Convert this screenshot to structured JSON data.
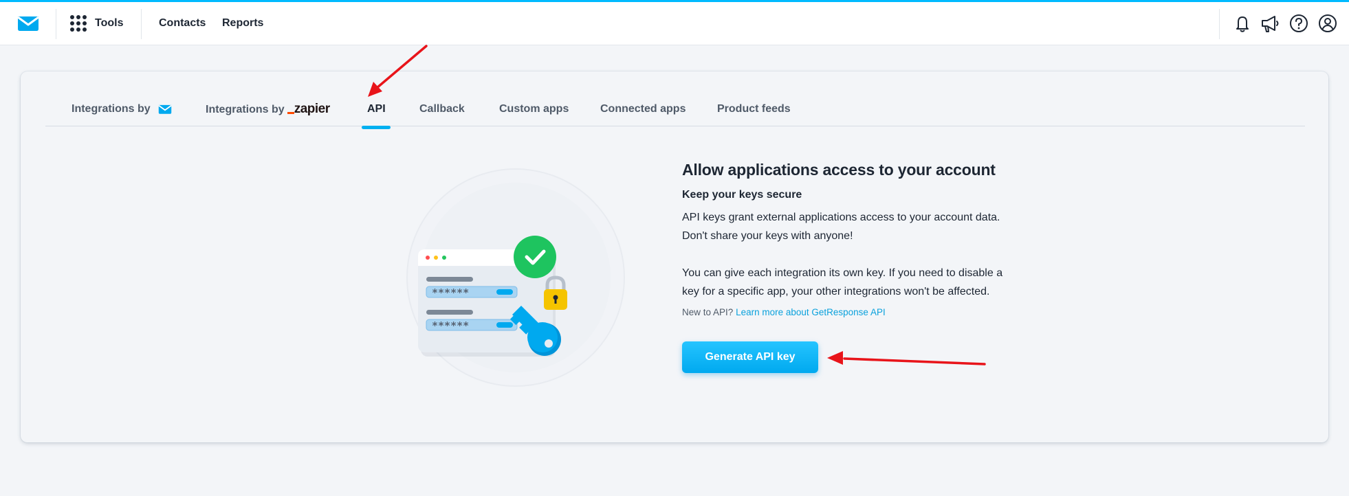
{
  "header": {
    "tools_label": "Tools",
    "nav": [
      "Contacts",
      "Reports"
    ],
    "right_icons": [
      "bell-icon",
      "megaphone-icon",
      "help-icon",
      "user-icon"
    ]
  },
  "tabs": [
    {
      "label": "Integrations by",
      "logo": "getresponse-envelope-icon"
    },
    {
      "label": "Integrations by",
      "logo_text": "zapier"
    },
    {
      "label": "API",
      "active": true
    },
    {
      "label": "Callback"
    },
    {
      "label": "Custom apps"
    },
    {
      "label": "Connected apps"
    },
    {
      "label": "Product feeds"
    }
  ],
  "main": {
    "headline": "Allow applications access to your account",
    "subhead": "Keep your keys secure",
    "para1_line1": "API keys grant external applications access to your account data.",
    "para1_line2": "Don't share your keys with anyone!",
    "para2_line1": "You can give each integration its own key. If you need to disable a",
    "para2_line2": "key for a specific app, your other integrations won't be affected.",
    "new_to_api": "New to API?",
    "learn_more": "Learn more about GetResponse API",
    "button": "Generate API key"
  },
  "illustration": {
    "password_mask": "******"
  },
  "colors": {
    "accent": "#00b0f0",
    "top_line": "#00baff",
    "check_green": "#1ec45f",
    "lock_yellow": "#f5c400",
    "annotation_red": "#e8141a"
  }
}
